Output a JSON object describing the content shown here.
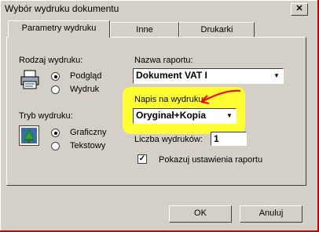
{
  "window": {
    "title": "Wybór wydruku dokumentu",
    "close_glyph": "✕"
  },
  "tabs": [
    {
      "label": "Parametry wydruku",
      "active": true
    },
    {
      "label": "Inne",
      "active": false
    },
    {
      "label": "Drukarki",
      "active": false
    }
  ],
  "print_type": {
    "label": "Rodzaj wydruku:",
    "options": [
      {
        "label": "Podgląd",
        "selected": true
      },
      {
        "label": "Wydruk",
        "selected": false
      }
    ]
  },
  "print_mode": {
    "label": "Tryb wydruku:",
    "options": [
      {
        "label": "Graficzny",
        "selected": true
      },
      {
        "label": "Tekstowy",
        "selected": false
      }
    ]
  },
  "report_name": {
    "label": "Nazwa raportu:",
    "value": "Dokument VAT I"
  },
  "print_caption": {
    "label": "Napis na wydruku:",
    "value": "Oryginał+Kopia"
  },
  "copies": {
    "label": "Liczba wydruków:",
    "value": "1"
  },
  "show_settings": {
    "label": "Pokazuj ustawienia raportu",
    "checked": true,
    "check_glyph": "✓"
  },
  "buttons": {
    "ok": "OK",
    "cancel": "Anuluj"
  },
  "colors": {
    "highlight": "#ffff33",
    "annotation": "#ff0000",
    "frame_edge": "#c00000"
  }
}
